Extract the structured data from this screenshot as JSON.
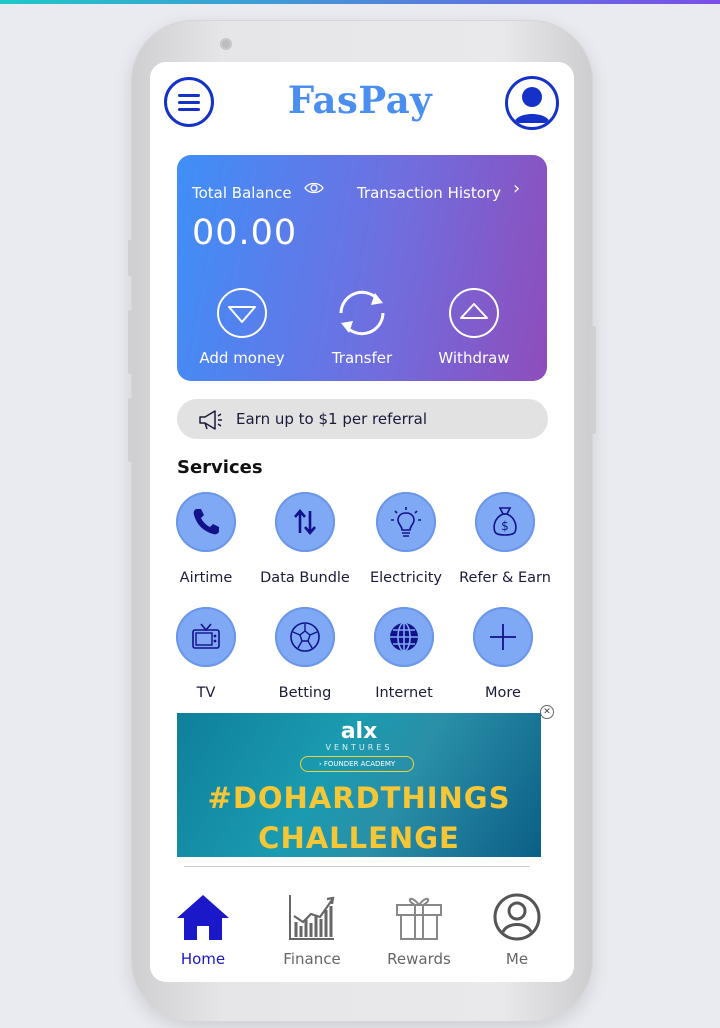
{
  "app": {
    "title": "FasPay"
  },
  "header": {
    "menu_icon": "hamburger-menu-icon",
    "profile_icon": "user-avatar-icon"
  },
  "balance": {
    "label": "Total Balance",
    "amount": "00.00",
    "history_label": "Transaction History",
    "history_arrow": "›",
    "actions": [
      {
        "label": "Add money",
        "icon": "download-arrow-icon"
      },
      {
        "label": "Transfer",
        "icon": "refresh-icon"
      },
      {
        "label": "Withdraw",
        "icon": "upload-arrow-icon"
      }
    ]
  },
  "referral_banner": {
    "text": "Earn up to $1 per referral",
    "icon": "megaphone-icon"
  },
  "services": {
    "title": "Services",
    "items": [
      {
        "label": "Airtime",
        "icon": "phone-icon"
      },
      {
        "label": "Data Bundle",
        "icon": "data-arrows-icon"
      },
      {
        "label": "Electricity",
        "icon": "lightbulb-icon"
      },
      {
        "label": "Refer & Earn",
        "icon": "money-bag-icon"
      },
      {
        "label": "TV",
        "icon": "tv-icon"
      },
      {
        "label": "Betting",
        "icon": "soccer-ball-icon"
      },
      {
        "label": "Internet",
        "icon": "globe-icon"
      },
      {
        "label": "More",
        "icon": "plus-icon"
      }
    ]
  },
  "ad": {
    "logo": "alx",
    "sub": "VENTURES",
    "pill": "› FOUNDER ACADEMY",
    "line1": "#DOHARDTHINGS",
    "line2": "CHALLENGE",
    "close": "✕"
  },
  "bottom_nav": [
    {
      "label": "Home",
      "icon": "home-icon",
      "active": true
    },
    {
      "label": "Finance",
      "icon": "bar-chart-icon",
      "active": false
    },
    {
      "label": "Rewards",
      "icon": "gift-icon",
      "active": false
    },
    {
      "label": "Me",
      "icon": "profile-icon",
      "active": false
    }
  ],
  "colors": {
    "brand": "#4a8ff0",
    "primary_dark": "#1432c8",
    "card_gradient_start": "#3f8ff8",
    "card_gradient_end": "#8e4dbb",
    "service_circle": "#7fa8f5",
    "nav_active": "#1a18c8",
    "ad_text": "#f5c736"
  }
}
